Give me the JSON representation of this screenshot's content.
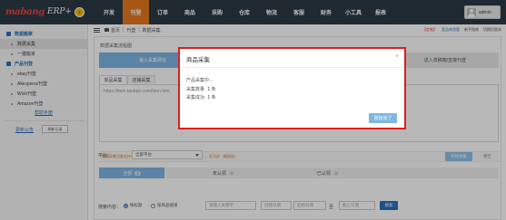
{
  "app": {
    "logo": "mabang",
    "logo_suffix": "ERP+"
  },
  "nav": [
    "开发",
    "刊登",
    "订单",
    "商品",
    "采购",
    "仓库",
    "物流",
    "客服",
    "财务",
    "小工具",
    "报表"
  ],
  "user": {
    "name": "admin"
  },
  "sidebar": {
    "group1": "数据搬家",
    "items1": [
      "数据采集",
      "一键搬家"
    ],
    "group2": "产品刊登",
    "items2": [
      "ebay刊登",
      "Aliexpress刊登",
      "Wish刊登",
      "Amazon刊登"
    ],
    "help": "帮助手册",
    "notice": "更新公告",
    "notice_button": "刷新记录"
  },
  "breadcrumb": {
    "home": "首页",
    "level1": "刊登",
    "level2": "数据采集"
  },
  "top_links": [
    "【定制】",
    "竞品体验版",
    "新手指南",
    "切换旧版本"
  ],
  "panel": {
    "head": "数据采集流程图",
    "step1": "输入采集网址",
    "step_last": "进入草稿箱/直接刊登",
    "tabs": [
      "单品采集",
      "店铺采集"
    ],
    "textarea_placeholder": "https://item.taobao.com/item.htm",
    "tip": "数据采集功能支持：淘宝、速卖通、1688、天猫、eBay（主站）、亚马逊（美国站）",
    "start_button": "开始采集",
    "clear_button": "清空"
  },
  "status_tabs": [
    {
      "label": "全部",
      "count": "1"
    },
    {
      "label": "未认领",
      "count": "0"
    },
    {
      "label": "已认领",
      "count": "0"
    }
  ],
  "filters": {
    "platform_label": "平台：",
    "platform_value": "全部平台",
    "search_label": "搜索内容：",
    "radio1": "按标题",
    "radio2": "按商品链接",
    "keyword_placeholder": "请输入关键字",
    "date_label": "创建日期",
    "date_start": "起始日期",
    "date_to": "至",
    "date_end": "截止日期",
    "search_button": "搜索"
  },
  "modal": {
    "title": "商品采集",
    "close": "×",
    "status": "产品采集中...",
    "count_label": "采集数量",
    "count_value": "1",
    "count_unit": "条",
    "success_label": "采集成功",
    "success_value": "1",
    "success_unit": "条",
    "ok_button": "我知道了"
  }
}
